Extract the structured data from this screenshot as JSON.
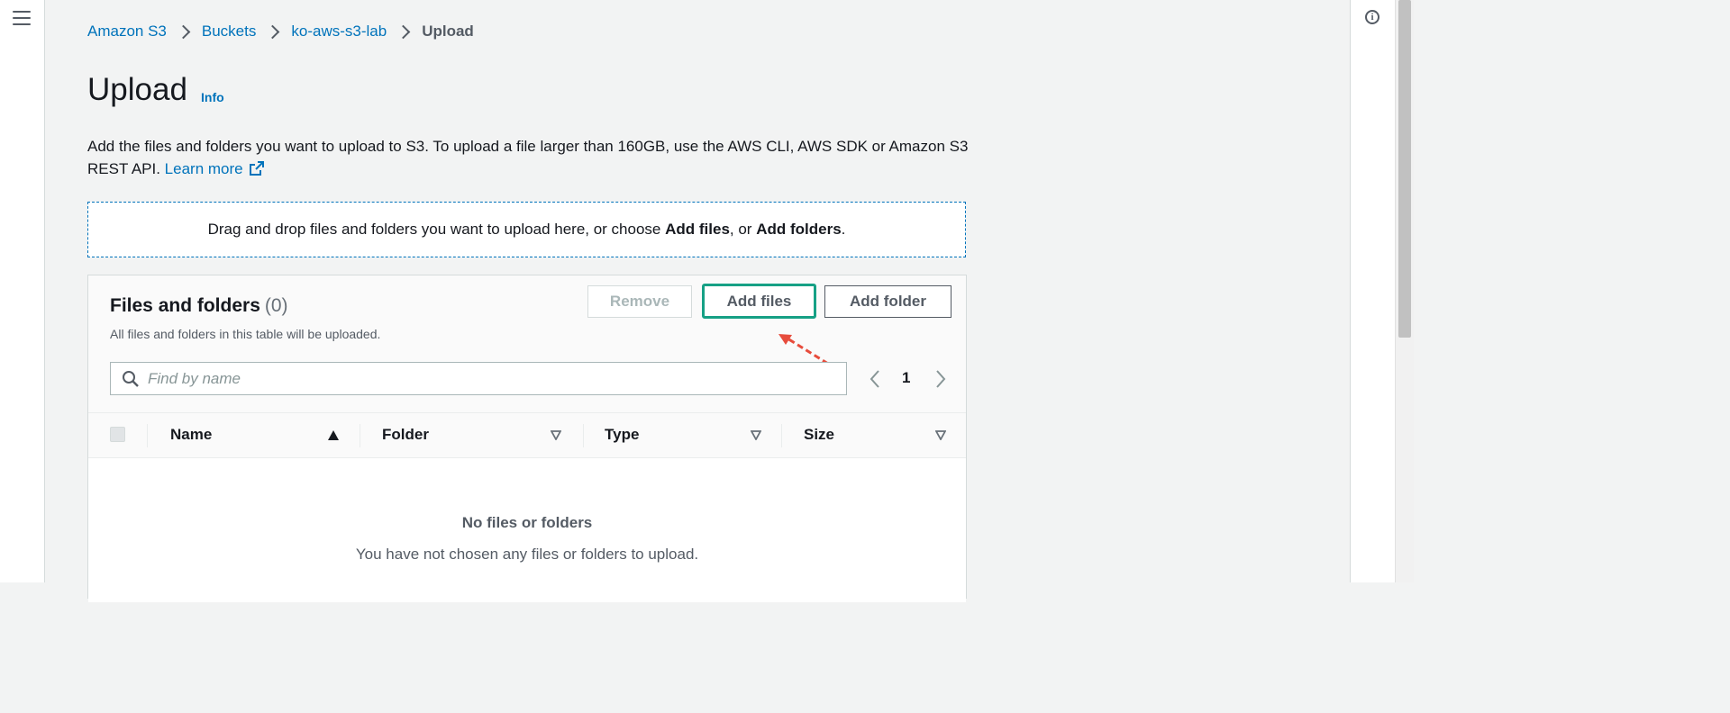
{
  "nav": {
    "menu_icon": "hamburger-icon"
  },
  "right_panel": {
    "info_icon": "info-circle-icon",
    "info_glyph": "i"
  },
  "breadcrumb": {
    "items": [
      "Amazon S3",
      "Buckets",
      "ko-aws-s3-lab"
    ],
    "current": "Upload"
  },
  "header": {
    "title": "Upload",
    "info_link": "Info"
  },
  "description": {
    "text": "Add the files and folders you want to upload to S3. To upload a file larger than 160GB, use the AWS CLI, AWS SDK or Amazon S3 REST API. ",
    "link": "Learn more",
    "link_icon": "external-link-icon"
  },
  "dropzone": {
    "prefix": "Drag and drop files and folders you want to upload here, or choose ",
    "add_files": "Add files",
    "middle": ", or ",
    "add_folders": "Add folders",
    "suffix": "."
  },
  "files_panel": {
    "title": "Files and folders",
    "count": "(0)",
    "subtitle": "All files and folders in this table will be uploaded.",
    "buttons": {
      "remove": "Remove",
      "add_files": "Add files",
      "add_folder": "Add folder"
    },
    "search": {
      "placeholder": "Find by name",
      "value": ""
    },
    "pagination": {
      "current_page": "1"
    },
    "columns": [
      "Name",
      "Folder",
      "Type",
      "Size"
    ],
    "empty": {
      "title": "No files or folders",
      "message": "You have not chosen any files or folders to upload."
    }
  },
  "annotation": {
    "arrow_color": "#e74c3c",
    "highlight_color": "#16a085"
  },
  "colors": {
    "link": "#0073bb",
    "background": "#f2f3f3",
    "text": "#16191f",
    "muted": "#545b64"
  }
}
